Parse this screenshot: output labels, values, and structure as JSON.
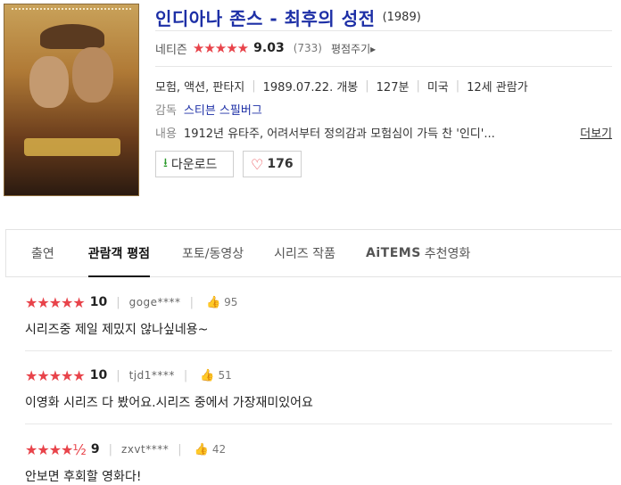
{
  "movie": {
    "title": "인디아나 존스 - 최후의 성전",
    "year": "(1989)",
    "rating_label": "네티즌",
    "stars": "★★★★★",
    "score": "9.03",
    "rating_count": "(733)",
    "rate_button": "평점주기▸",
    "genre": "모험, 액션, 판타지",
    "release": "1989.07.22. 개봉",
    "runtime": "127분",
    "country": "미국",
    "age_rating": "12세 관람가",
    "director_label": "감독",
    "director": "스티븐 스필버그",
    "plot_label": "내용",
    "plot": "1912년 유타주, 어려서부터 정의감과 모험심이 가득 찬 '인디'...",
    "more_link": "더보기",
    "download_label": "다운로드",
    "like_count": "176"
  },
  "tabs": [
    {
      "label": "출연"
    },
    {
      "label": "관람객 평점"
    },
    {
      "label": "포토/동영상"
    },
    {
      "label": "시리즈 작품"
    },
    {
      "label": "AiTEMS",
      "suffix": "추천영화"
    }
  ],
  "reviews": [
    {
      "stars": "★★★★★",
      "score": "10",
      "user": "goge****",
      "likes": "95",
      "text": "시리즈중 제일 제밌지 않나싶네용~"
    },
    {
      "stars": "★★★★★",
      "score": "10",
      "user": "tjd1****",
      "likes": "51",
      "text": "이영화 시리즈 다 봤어요.시리즈 중에서 가장재미있어요"
    },
    {
      "stars": "★★★★½",
      "score": "9",
      "user": "zxvt****",
      "likes": "42",
      "text": "안보면 후회할 영화다!"
    }
  ],
  "colors": {
    "accent": "#1d2fa6",
    "star": "#e8434a"
  }
}
